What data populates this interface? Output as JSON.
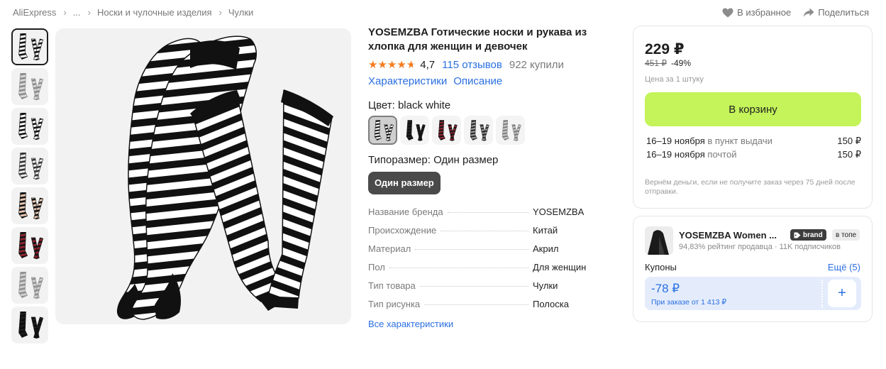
{
  "breadcrumb": [
    {
      "label": "AliExpress"
    },
    {
      "label": "..."
    },
    {
      "label": "Носки и чулочные изделия"
    },
    {
      "label": "Чулки"
    }
  ],
  "top_actions": {
    "favorite_label": "В избранное",
    "share_label": "Поделиться"
  },
  "product": {
    "title": "YOSEMZBA Готические носки и рукава из хлопка для женщин и девочек",
    "rating": "4,7",
    "rating_value": 4.7,
    "reviews": "115 отзывов",
    "bought": "922 купили",
    "links": [
      "Характеристики",
      "Описание"
    ],
    "color_label": "Цвет: black white",
    "swatches": [
      {
        "name": "black white",
        "colors": [
          "#ffffff",
          "#111111"
        ]
      },
      {
        "name": "black",
        "colors": [
          "#111111",
          "#111111"
        ]
      },
      {
        "name": "red black",
        "colors": [
          "#8c1f2a",
          "#111111"
        ]
      },
      {
        "name": "grey black",
        "colors": [
          "#9a9a9a",
          "#222222"
        ]
      },
      {
        "name": "grey white",
        "colors": [
          "#c8c8c8",
          "#7a7a7a"
        ]
      }
    ],
    "size_label": "Типоразмер: Один размер",
    "size_value": "Один размер",
    "specs": [
      {
        "key": "Название бренда",
        "value": "YOSEMZBA"
      },
      {
        "key": "Происхождение",
        "value": "Китай"
      },
      {
        "key": "Материал",
        "value": "Акрил"
      },
      {
        "key": "Пол",
        "value": "Для женщин"
      },
      {
        "key": "Тип товара",
        "value": "Чулки"
      },
      {
        "key": "Тип рисунка",
        "value": "Полоска"
      }
    ],
    "all_specs_label": "Все характеристики"
  },
  "buy": {
    "price": "229 ₽",
    "old_price": "451 ₽",
    "discount": "-49%",
    "unit_note": "Цена за 1 штуку",
    "cart_label": "В корзину",
    "shipping": [
      {
        "date": "16–19 ноября",
        "method": "в пункт выдачи",
        "cost": "150 ₽"
      },
      {
        "date": "16–19 ноября",
        "method": "почтой",
        "cost": "150 ₽"
      }
    ],
    "refund_note": "Вернём деньги, если не получите заказ через 75 дней после отправки."
  },
  "seller": {
    "name": "YOSEMZBA Women ...",
    "badge_brand": "brand",
    "badge_top": "в топе",
    "meta": "94,83% рейтинг продавца · 11K подписчиков",
    "coupons_label": "Купоны",
    "coupons_all": "Ещё (5)",
    "coupon_amount": "-78 ₽",
    "coupon_condition": "При заказе от 1 413 ₽"
  },
  "thumbnails": [
    {
      "name": "black white socks and sleeves",
      "colors": [
        "#ffffff",
        "#111111"
      ]
    },
    {
      "name": "grey socks and sleeves",
      "colors": [
        "#d8d8d8",
        "#8a8a8a"
      ]
    },
    {
      "name": "black white socks and sleeves 2",
      "colors": [
        "#ffffff",
        "#111111"
      ]
    },
    {
      "name": "model legs photo",
      "colors": [
        "#eeeeee",
        "#333333"
      ]
    },
    {
      "name": "sleeves on arms photo",
      "colors": [
        "#e9c9b2",
        "#111111"
      ]
    },
    {
      "name": "red black socks and sleeves",
      "colors": [
        "#8c1f2a",
        "#111111"
      ]
    },
    {
      "name": "grey white socks and sleeves",
      "colors": [
        "#cfcfcf",
        "#8f8f8f"
      ]
    },
    {
      "name": "black socks and sleeves",
      "colors": [
        "#111111",
        "#111111"
      ]
    }
  ],
  "colors": {
    "link": "#2a6fe0",
    "cart_button": "#c4f35a",
    "star": "#f57c1f",
    "coupon_bg": "#e4ecfc"
  }
}
